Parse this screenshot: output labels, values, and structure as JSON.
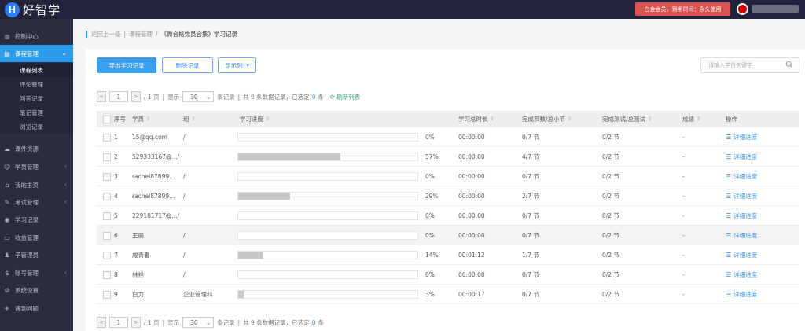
{
  "app": {
    "logo_letter": "H",
    "logo_text": "好智学"
  },
  "topbar": {
    "vip_text": "白金会员，到期时间：永久使用",
    "username": "████████"
  },
  "sidebar": {
    "items": [
      {
        "label": "控制中心",
        "icon": "dashboard-icon",
        "glyph": "◍",
        "arrow": ""
      },
      {
        "label": "课程管理",
        "icon": "book-icon",
        "glyph": "▤",
        "arrow": "⌄",
        "active": true
      },
      {
        "label": "课件资源",
        "icon": "cloud-icon",
        "glyph": "☁",
        "arrow": ""
      },
      {
        "label": "学员管理",
        "icon": "users-icon",
        "glyph": "☺",
        "arrow": "‹"
      },
      {
        "label": "我的主页",
        "icon": "home-icon",
        "glyph": "⌂",
        "arrow": "‹"
      },
      {
        "label": "考试管理",
        "icon": "tag-icon",
        "glyph": "✎",
        "arrow": "‹"
      },
      {
        "label": "学习记录",
        "icon": "record-icon",
        "glyph": "◉",
        "arrow": ""
      },
      {
        "label": "收益管理",
        "icon": "wallet-icon",
        "glyph": "▭",
        "arrow": ""
      },
      {
        "label": "子管理员",
        "icon": "person-icon",
        "glyph": "♟",
        "arrow": ""
      },
      {
        "label": "账号管理",
        "icon": "dollar-icon",
        "glyph": "$",
        "arrow": "‹"
      },
      {
        "label": "系统设置",
        "icon": "gear-icon",
        "glyph": "⚙",
        "arrow": ""
      },
      {
        "label": "遇到问题",
        "icon": "help-icon",
        "glyph": "✈",
        "arrow": ""
      }
    ],
    "submenu": [
      "课程列表",
      "评论管理",
      "问答记录",
      "笔记管理",
      "浏览记录"
    ]
  },
  "breadcrumb": {
    "back": "返回上一级",
    "sep": "|",
    "parent": "课程管理",
    "slash": "/",
    "current": "《微合格党员合集》学习记录"
  },
  "toolbar": {
    "export": "导出学习记录",
    "delete": "删除记录",
    "columns": "显示列",
    "columns_caret": "▾"
  },
  "search": {
    "placeholder": "请输入学员关键字"
  },
  "pager": {
    "prev": "<",
    "next": ">",
    "page": "1",
    "total_pages": "/ 1 页",
    "show": "显示",
    "page_size": "30",
    "caret": "⌄",
    "per": "条记录",
    "summary_a": "共 9 条数据记录，已选定",
    "selected": "0",
    "summary_b": "条",
    "refresh": "刷新列表",
    "sep": "|"
  },
  "table": {
    "headers": [
      "序号",
      "学员",
      "组",
      "学习进度",
      "学习总时长",
      "完成节数/总小节",
      "完成测试/总测试",
      "成绩",
      "操作"
    ],
    "rows": [
      {
        "no": "1",
        "student": "15@qq.com",
        "group": "/",
        "progress": 0,
        "progress_text": "0%",
        "time": "00:00:00",
        "sections": "0/7 节",
        "tests": "0/2 节",
        "score": "-",
        "op": "详细进度"
      },
      {
        "no": "2",
        "student": "529333167@.../",
        "group": "",
        "progress": 57,
        "progress_text": "57%",
        "time": "00:00:00",
        "sections": "4/7 节",
        "tests": "0/2 节",
        "score": "-",
        "op": "详细进度"
      },
      {
        "no": "3",
        "student": "rachel87899...",
        "group": "/",
        "progress": 0,
        "progress_text": "0%",
        "time": "00:00:00",
        "sections": "0/7 节",
        "tests": "0/2 节",
        "score": "-",
        "op": "详细进度"
      },
      {
        "no": "4",
        "student": "rachel87899...",
        "group": "/",
        "progress": 29,
        "progress_text": "29%",
        "time": "00:00:00",
        "sections": "2/7 节",
        "tests": "0/2 节",
        "score": "-",
        "op": "详细进度"
      },
      {
        "no": "5",
        "student": "229181717@.../",
        "group": "",
        "progress": 0,
        "progress_text": "0%",
        "time": "00:00:00",
        "sections": "0/7 节",
        "tests": "0/2 节",
        "score": "-",
        "op": "详细进度"
      },
      {
        "no": "6",
        "student": "王丽",
        "group": "/",
        "progress": 0,
        "progress_text": "0%",
        "time": "00:00:00",
        "sections": "0/7 节",
        "tests": "0/2 节",
        "score": "-",
        "op": "详细进度",
        "highlight": true
      },
      {
        "no": "7",
        "student": "戚青春",
        "group": "/",
        "progress": 14,
        "progress_text": "14%",
        "time": "00:01:12",
        "sections": "1/7 节",
        "tests": "0/2 节",
        "score": "-",
        "op": "详细进度"
      },
      {
        "no": "8",
        "student": "林祥",
        "group": "/",
        "progress": 0,
        "progress_text": "0%",
        "time": "00:00:00",
        "sections": "0/7 节",
        "tests": "0/2 节",
        "score": "-",
        "op": "详细进度"
      },
      {
        "no": "9",
        "student": "白力",
        "group": "企业管理科",
        "progress": 3,
        "progress_text": "3%",
        "time": "00:00:17",
        "sections": "0/7 节",
        "tests": "0/2 节",
        "score": "-",
        "op": "详细进度"
      }
    ]
  }
}
